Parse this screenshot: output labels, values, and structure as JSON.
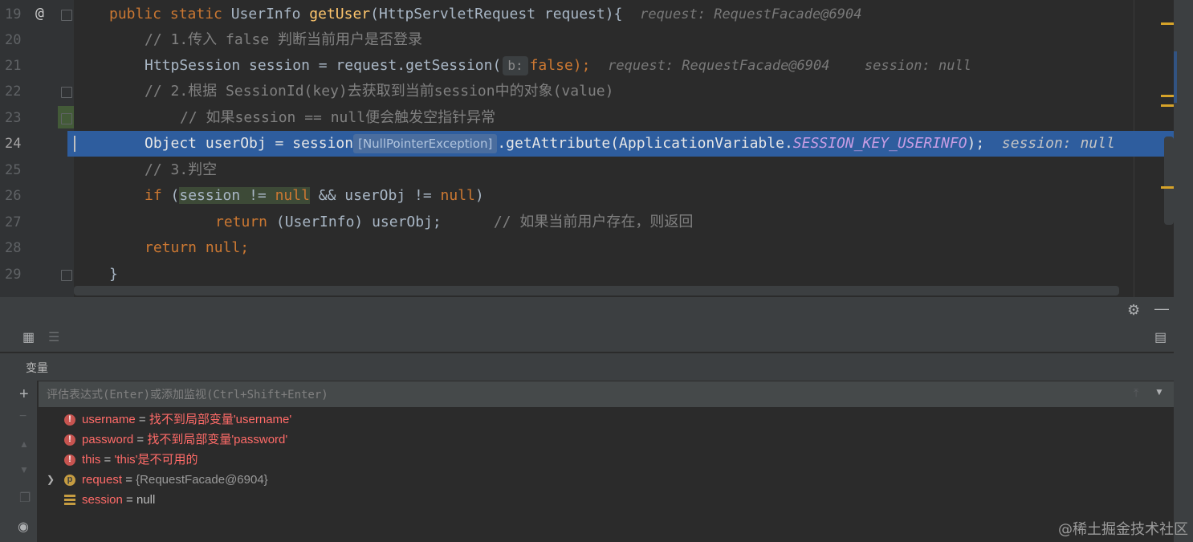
{
  "editor": {
    "lines": [
      {
        "num": "19",
        "kind": "sig"
      },
      {
        "num": "20",
        "kind": "c1"
      },
      {
        "num": "21",
        "kind": "getSession"
      },
      {
        "num": "22",
        "kind": "c2"
      },
      {
        "num": "23",
        "kind": "c3"
      },
      {
        "num": "24",
        "kind": "getAttr"
      },
      {
        "num": "25",
        "kind": "c4"
      },
      {
        "num": "26",
        "kind": "if"
      },
      {
        "num": "27",
        "kind": "ret1"
      },
      {
        "num": "28",
        "kind": "ret2"
      },
      {
        "num": "29",
        "kind": "close"
      }
    ],
    "l19": {
      "kw1": "public static ",
      "type": "UserInfo ",
      "fn": "getUser",
      "args": "(HttpServletRequest request){",
      "hint": "request: RequestFacade@6904"
    },
    "l20": "// 1.传入 false 判断当前用户是否登录",
    "l21": {
      "pre": "HttpSession session = request.getSession(",
      "inlay": "b:",
      "kw": "false",
      "post": ");",
      "hint1": "request: RequestFacade@6904",
      "hint2": "session: null"
    },
    "l22": "// 2.根据 SessionId(key)去获取到当前session中的对象(value)",
    "l23": "// 如果session == null便会触发空指针异常",
    "l24": {
      "pre": "Object userObj = session",
      "npe": "[NullPointerException]",
      "mid": ".getAttribute(ApplicationVariable.",
      "const": "SESSION_KEY_USERINFO",
      "post": ");",
      "hint": "session: null"
    },
    "l25": "// 3.判空",
    "l26": {
      "kw": "if",
      "open": " (",
      "sess": "session != ",
      "null1": "null",
      "mid": " && userObj != ",
      "null2": "null",
      "close": ")"
    },
    "l27": {
      "kw": "return",
      "code": " (UserInfo) userObj;",
      "comment": "// 如果当前用户存在，则返回"
    },
    "l28": {
      "kw": "return null;"
    },
    "l29": "}"
  },
  "debug": {
    "variables_title": "变量",
    "eval_placeholder": "评估表达式(Enter)或添加监视(Ctrl+Shift+Enter)",
    "vars": [
      {
        "icon": "error-icon",
        "name": "username",
        "eq": " = ",
        "value": "找不到局部变量'username'",
        "style": "err"
      },
      {
        "icon": "error-icon",
        "name": "password",
        "eq": " = ",
        "value": "找不到局部变量'password'",
        "style": "err"
      },
      {
        "icon": "error-icon",
        "name": "this",
        "eq": " = ",
        "value": "'this'是不可用的",
        "style": "err"
      },
      {
        "icon": "parameter-icon",
        "name": "request",
        "eq": " = ",
        "value": "{RequestFacade@6904}",
        "style": "obj"
      },
      {
        "icon": "primitive-icon",
        "name": "session",
        "eq": " = ",
        "value": "null",
        "style": "plain"
      }
    ]
  },
  "watermark": "@稀土掘金技术社区",
  "colors": {
    "background": "#2b2b2b",
    "keyword": "#cc7832",
    "function": "#ffc66d",
    "comment": "#808080",
    "constant": "#9876aa",
    "highlight": "#2e5d9e",
    "error": "#ff6b68"
  }
}
